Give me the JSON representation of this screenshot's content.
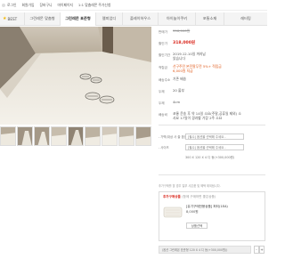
{
  "topbar": {
    "items": [
      "로그인",
      "회원가입",
      "장바구니",
      "마이페이지",
      "1:1 맞춤레몬 주가신청"
    ]
  },
  "nav": {
    "items": [
      "BEST",
      "그린레몬 맞춤형",
      "그린레몬 표준형",
      "렐피업디",
      "플레이하우스",
      "아이놀이쿠키",
      "포통소재",
      "레터밍"
    ]
  },
  "product": {
    "rows": [
      {
        "k": "판매가",
        "v": "358,000원",
        "style": "strike"
      },
      {
        "k": "할인가",
        "v": "318,000원",
        "style": "red"
      },
      {
        "k": "할인기간",
        "v": "2019.12.10일 까지남았습니다",
        "style": ""
      },
      {
        "k": "적립금",
        "v": "선구주민 본전팔무전 5%+ 적립금 6,000원 지급",
        "style": "orange"
      },
      {
        "k": "배송주소",
        "v": "기존 배송",
        "style": ""
      },
      {
        "k": "두께",
        "v": "20 울부",
        "style": ""
      },
      {
        "k": "두께",
        "v": "4cm",
        "style": ""
      },
      {
        "k": "배송비",
        "v": "코롱 운송 후 약 14일 소요(주말,공휴일 제외) 소사요 17일이 경과할 가장 2주 소요",
        "style": ""
      }
    ],
    "options": [
      {
        "k": "- 가벽(대상 사 출 옵션)",
        "v": "[필수] 옵션을 선택해 주세요 -",
        "type": "select"
      },
      {
        "k": "- 사이즈",
        "v": "[필수] 옵션을 선택해 주세요 -",
        "type": "select"
      },
      {
        "k": "",
        "v": "300 X 120 X 4 디 동(+300,000원)",
        "type": "text"
      }
    ],
    "note": "추가구매를 할 경우 일부 사은품 및 혜택 제외됩니다."
  },
  "extra": {
    "header": "추가구매상품",
    "header_sub": "(함께 구매하면 좋은상품)",
    "product_name": "[유기구매전용상품] 퍼티(1EA)",
    "product_price": "8,000원",
    "button": "상품선택"
  },
  "summary": {
    "text": "(옵션 그린레몬 표준형 120 X 4 디 동(+300,000원))",
    "minus": "-",
    "plus": "+"
  },
  "colors": {
    "accent_red": "#d9261c",
    "orange": "#e05a1b",
    "nav_bg": "#f4f4f4"
  }
}
